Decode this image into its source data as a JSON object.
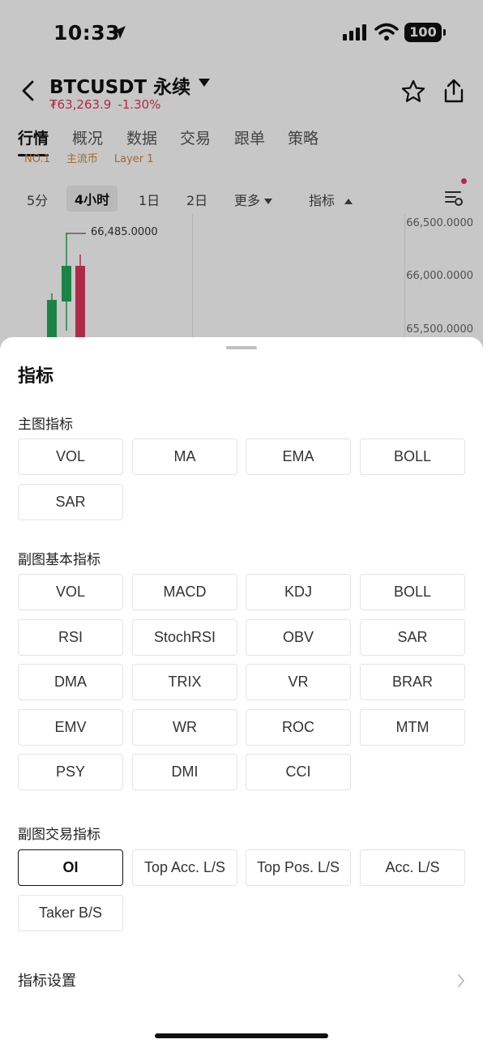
{
  "status_bar": {
    "time": "10:33",
    "battery": "100"
  },
  "header": {
    "symbol": "BTCUSDT 永续",
    "price": "₮63,263.9",
    "change": "-1.30%"
  },
  "tabs": [
    "行情",
    "概况",
    "数据",
    "交易",
    "跟单",
    "策略"
  ],
  "tags": [
    "NO.1",
    "主流币",
    "Layer 1"
  ],
  "intervals": {
    "m5": "5分",
    "h4": "4小时",
    "d1": "1日",
    "d2": "2日",
    "more": "更多",
    "indicator": "指标"
  },
  "chart": {
    "y_labels": [
      "66,500.0000",
      "66,000.0000",
      "65,500.0000"
    ],
    "high_marker": "66,485.0000"
  },
  "sheet": {
    "title": "指标",
    "main_section": "主图指标",
    "main_options": [
      "VOL",
      "MA",
      "EMA",
      "BOLL",
      "SAR"
    ],
    "sub_basic_section": "副图基本指标",
    "sub_basic_options": [
      "VOL",
      "MACD",
      "KDJ",
      "BOLL",
      "RSI",
      "StochRSI",
      "OBV",
      "SAR",
      "DMA",
      "TRIX",
      "VR",
      "BRAR",
      "EMV",
      "WR",
      "ROC",
      "MTM",
      "PSY",
      "DMI",
      "CCI"
    ],
    "sub_trade_section": "副图交易指标",
    "sub_trade_options": [
      "OI",
      "Top Acc. L/S",
      "Top Pos. L/S",
      "Acc. L/S",
      "Taker B/S"
    ],
    "selected": "OI",
    "settings_label": "指标设置"
  },
  "colors": {
    "up": "#22a85a",
    "down": "#e0365e"
  }
}
